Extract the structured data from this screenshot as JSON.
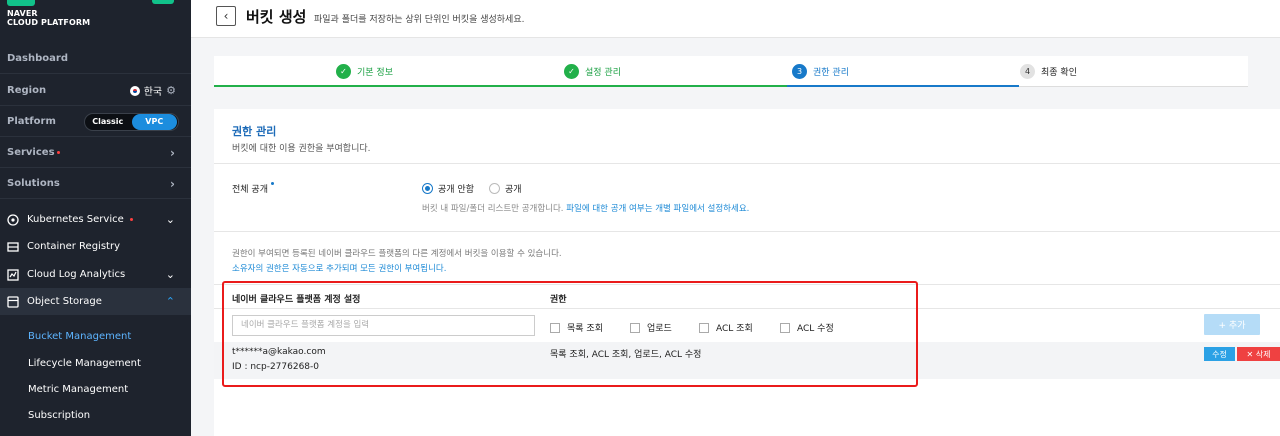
{
  "brand": {
    "line1": "NAVER",
    "line2": "CLOUD PLATFORM"
  },
  "sidebar": {
    "dashboard": "Dashboard",
    "region_label": "Region",
    "region_value": "한국",
    "platform_label": "Platform",
    "platform_options": [
      "Classic",
      "VPC"
    ],
    "platform_selected": "VPC",
    "services": "Services",
    "solutions": "Solutions",
    "items": [
      {
        "label": "Kubernetes Service",
        "icon": "kubernetes-icon"
      },
      {
        "label": "Container Registry",
        "icon": "registry-icon"
      },
      {
        "label": "Cloud Log Analytics",
        "icon": "log-analytics-icon"
      },
      {
        "label": "Object Storage",
        "icon": "storage-icon"
      }
    ],
    "sub_items": [
      "Bucket Management",
      "Lifecycle Management",
      "Metric Management",
      "Subscription"
    ],
    "active_sub": "Bucket Management"
  },
  "header": {
    "title": "버킷 생성",
    "subtitle": "파일과 폴더를 저장하는 상위 단위인 버킷을 생성하세요."
  },
  "steps": [
    {
      "num": "✓",
      "label": "기본 정보",
      "state": "done"
    },
    {
      "num": "✓",
      "label": "설정 관리",
      "state": "done"
    },
    {
      "num": "3",
      "label": "권한 관리",
      "state": "current"
    },
    {
      "num": "4",
      "label": "최종 확인",
      "state": "todo"
    }
  ],
  "section": {
    "title": "권한 관리",
    "desc": "버킷에 대한 이용 권한을 부여합니다."
  },
  "public_access": {
    "label": "전체 공개",
    "options": [
      "공개 안함",
      "공개"
    ],
    "selected": "공개 안함",
    "help_prefix": "버킷 내 파일/폴더 리스트만 공개합니다.",
    "help_link": "파일에 대한 공개 여부는 개별 파일에서 설정하세요."
  },
  "notes": {
    "line1": "권한이 부여되면 등록된 네이버 클라우드 플랫폼의 다른 계정에서 버킷을 이용할 수 있습니다.",
    "line2": "소유자의 권한은 자동으로 추가되며 모든 권한이 부여됩니다."
  },
  "perm_table": {
    "col_account": "네이버 클라우드 플랫폼 계정 설정",
    "col_perm": "권한",
    "input_placeholder": "네이버 클라우드 플랫폼 계정을 입력",
    "checkboxes": [
      "목록 조회",
      "업로드",
      "ACL 조회",
      "ACL 수정"
    ],
    "add_label": "+ 추가",
    "rows": [
      {
        "email": "t******a@kakao.com",
        "id": "ID : ncp-2776268-0",
        "perms": "목록 조회, ACL 조회, 업로드, ACL 수정",
        "edit": "수정",
        "delete": "✕ 삭제"
      }
    ]
  },
  "colors": {
    "accent": "#1779c9",
    "done": "#22b04a",
    "highlight": "#ea1b1b"
  }
}
